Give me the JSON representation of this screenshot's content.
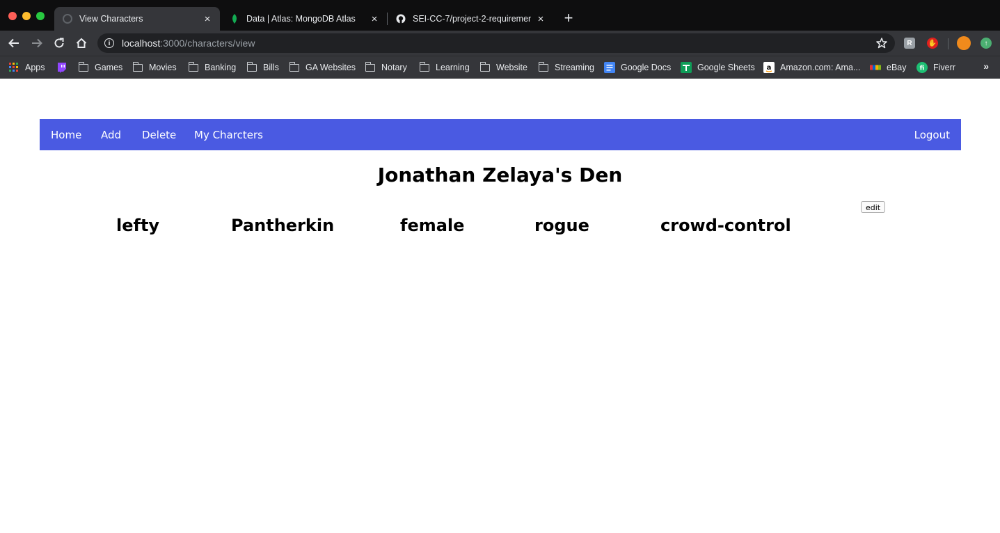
{
  "browser": {
    "tabs": [
      {
        "title": "View Characters",
        "icon": "loading-globe-icon",
        "active": true
      },
      {
        "title": "Data | Atlas: MongoDB Atlas",
        "icon": "mongodb-leaf-icon",
        "active": false
      },
      {
        "title": "SEI-CC-7/project-2-requirement",
        "icon": "github-icon",
        "active": false
      }
    ],
    "tab_close": "×",
    "new_tab": "+",
    "url_host": "localhost",
    "url_rest": ":3000/characters/view",
    "bookmarks": [
      {
        "label": "Apps",
        "icon": "apps-grid-icon"
      },
      {
        "label": "",
        "icon": "twitch-icon"
      },
      {
        "label": "Games",
        "icon": "folder-icon"
      },
      {
        "label": "Movies",
        "icon": "folder-icon"
      },
      {
        "label": "Banking",
        "icon": "folder-icon"
      },
      {
        "label": "Bills",
        "icon": "folder-icon"
      },
      {
        "label": "GA Websites",
        "icon": "folder-icon"
      },
      {
        "label": "Notary",
        "icon": "folder-icon"
      },
      {
        "label": "Learning",
        "icon": "folder-icon"
      },
      {
        "label": "Website",
        "icon": "folder-icon"
      },
      {
        "label": "Streaming",
        "icon": "folder-icon"
      },
      {
        "label": "Google Docs",
        "icon": "google-docs-icon"
      },
      {
        "label": "Google Sheets",
        "icon": "google-sheets-icon"
      },
      {
        "label": "Amazon.com: Ama...",
        "icon": "amazon-icon"
      },
      {
        "label": "eBay",
        "icon": "ebay-icon"
      },
      {
        "label": "Fiverr",
        "icon": "fiverr-icon"
      }
    ],
    "more_bookmarks": "»",
    "colors": {
      "tab_bar": "#0e0e0f",
      "toolbar": "#35363a",
      "omnibox": "#202124"
    }
  },
  "page": {
    "nav": {
      "home": "Home",
      "add": "Add",
      "delete": "Delete",
      "my_characters": "My Charcters",
      "logout": "Logout"
    },
    "title": "Jonathan Zelaya's Den",
    "edit_label": "edit",
    "character": {
      "name": "lefty",
      "race": "Pantherkin",
      "gender": "female",
      "class": "rogue",
      "role": "crowd-control"
    },
    "colors": {
      "navbar": "#4a5ae2",
      "nav_text": "#ffffff"
    }
  }
}
